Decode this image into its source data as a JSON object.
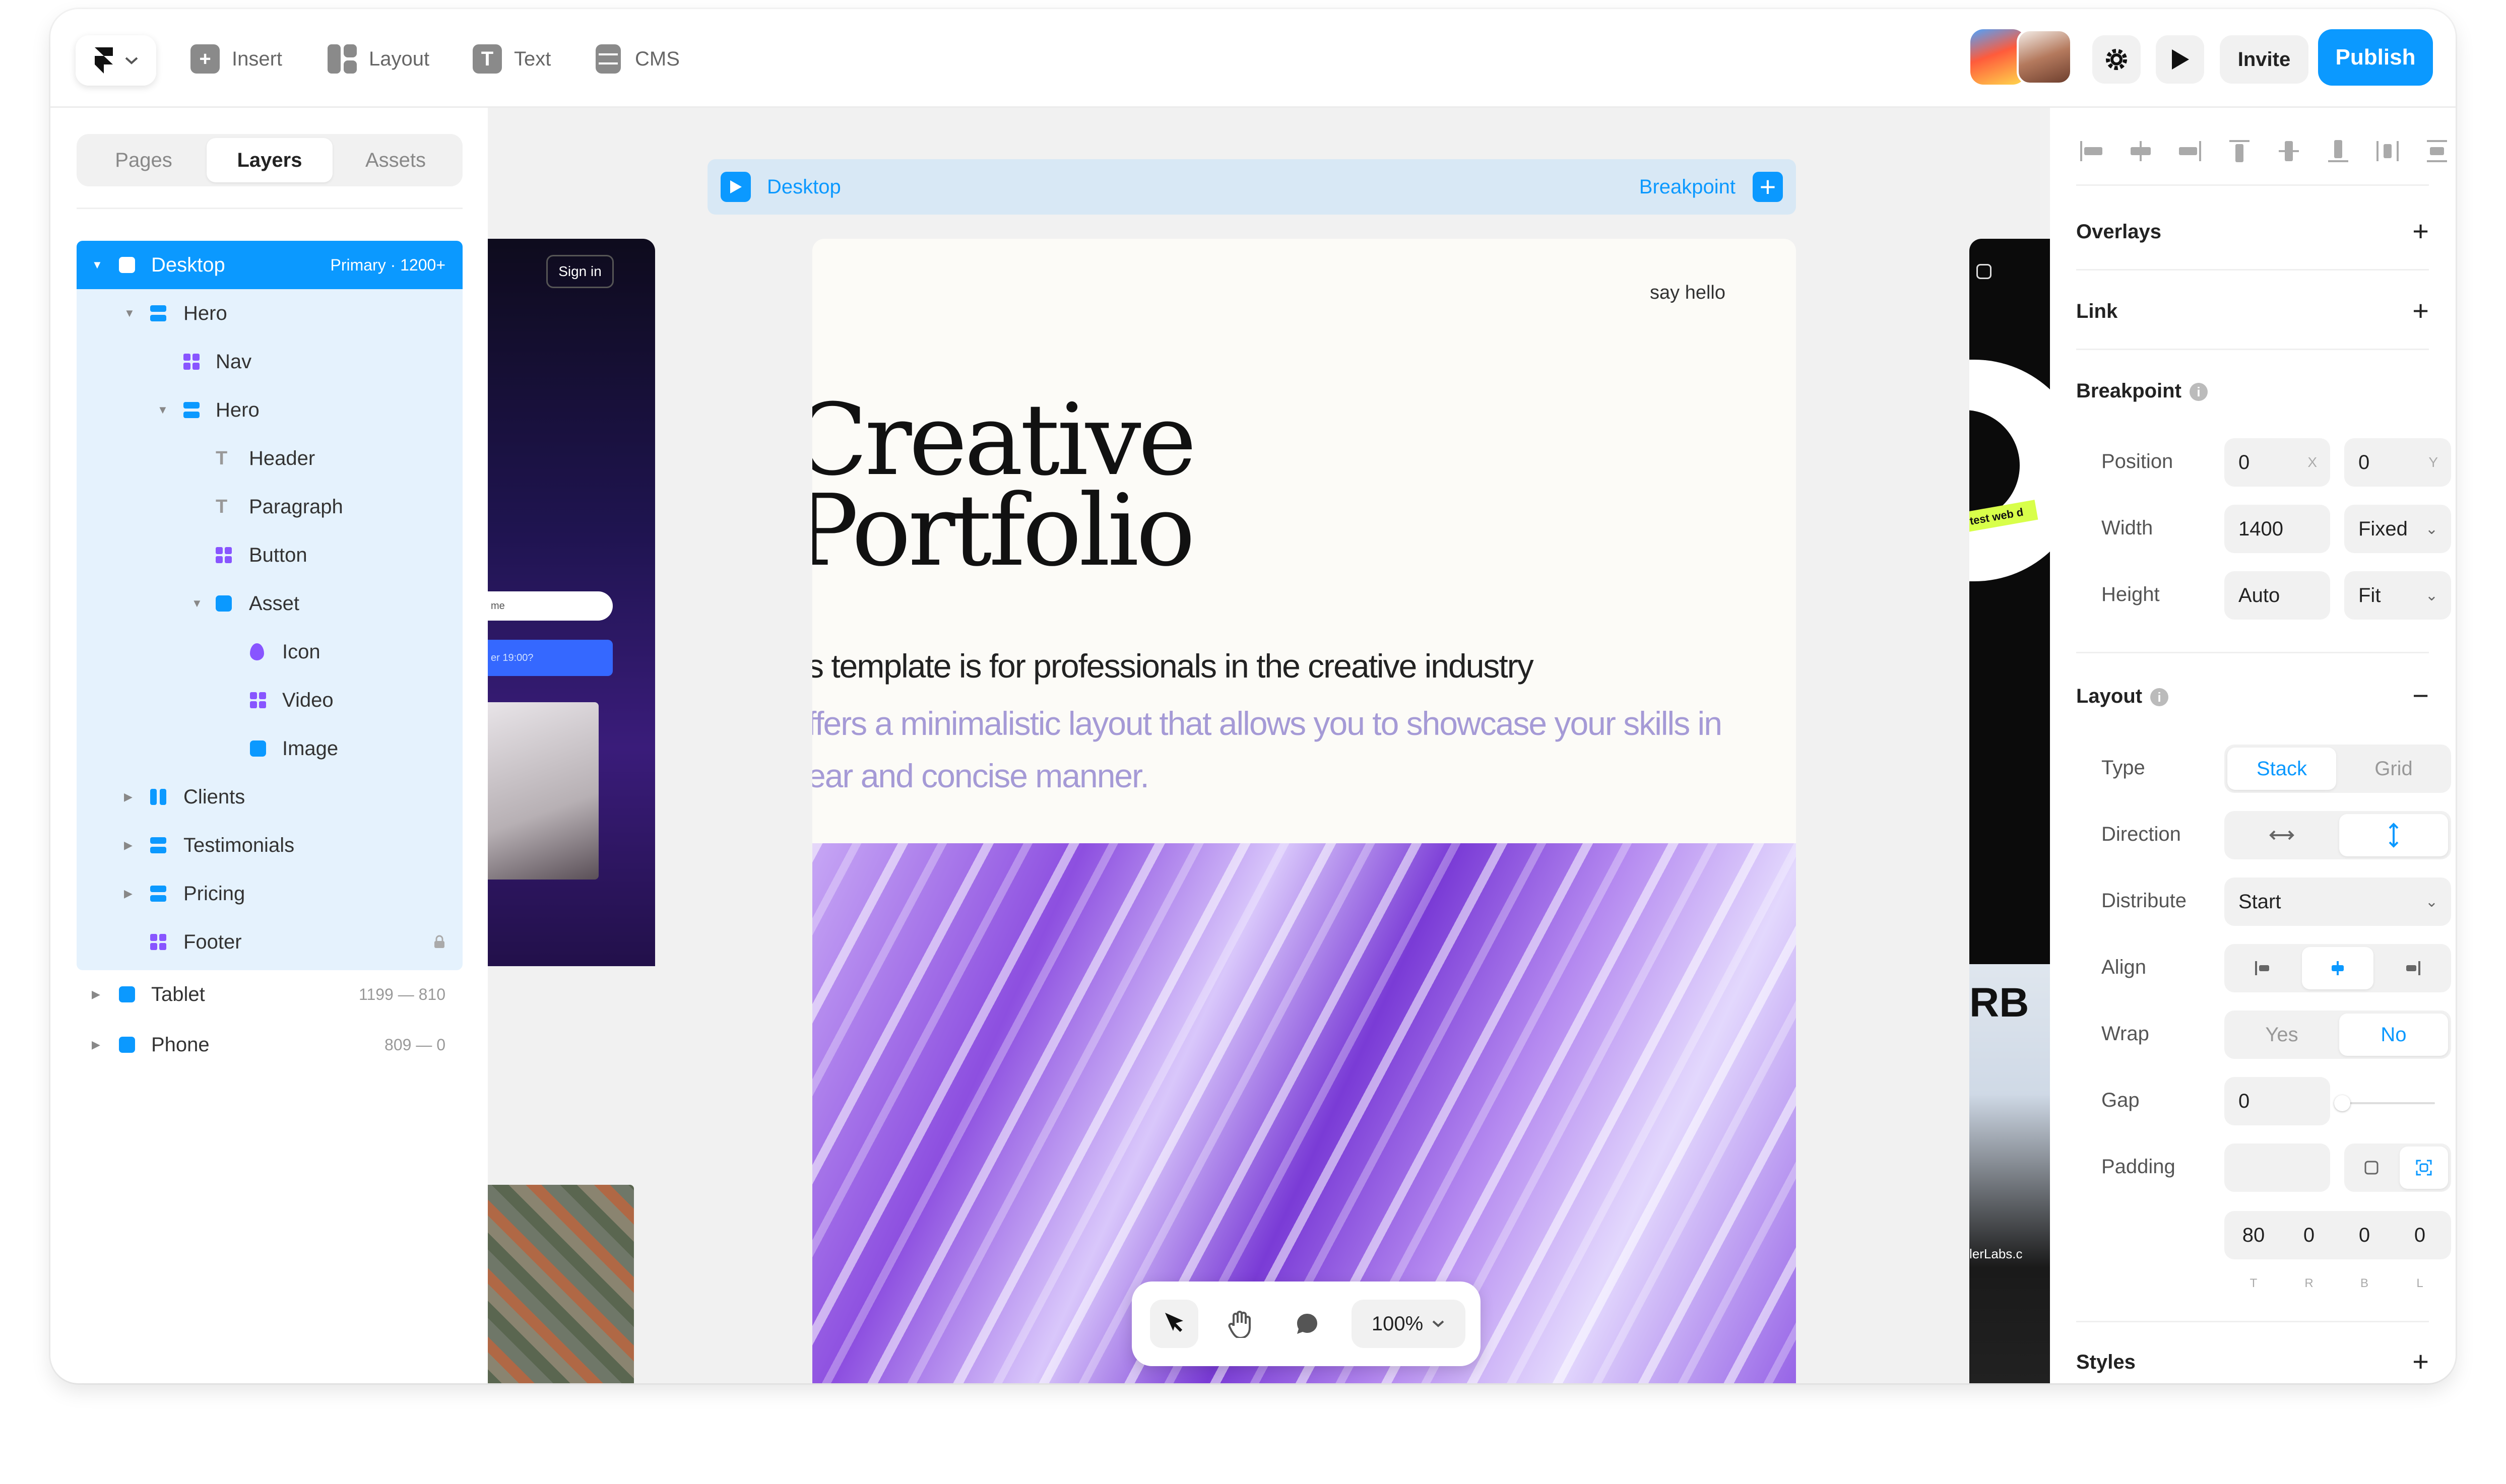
{
  "toolbar": {
    "menu_items": [
      {
        "label": "Insert",
        "icon": "plus-square-icon"
      },
      {
        "label": "Layout",
        "icon": "layout-icon"
      },
      {
        "label": "Text",
        "icon": "text-icon"
      },
      {
        "label": "CMS",
        "icon": "database-icon"
      }
    ],
    "invite_label": "Invite",
    "publish_label": "Publish",
    "accent_color": "#0b99ff"
  },
  "left_panel": {
    "tabs": [
      {
        "label": "Pages",
        "active": false
      },
      {
        "label": "Layers",
        "active": true
      },
      {
        "label": "Assets",
        "active": false
      }
    ],
    "layers": [
      {
        "label": "Desktop",
        "meta": "Primary · 1200+",
        "selected": true
      },
      {
        "label": "Hero"
      },
      {
        "label": "Nav"
      },
      {
        "label": "Hero"
      },
      {
        "label": "Header"
      },
      {
        "label": "Paragraph"
      },
      {
        "label": "Button"
      },
      {
        "label": "Asset"
      },
      {
        "label": "Icon"
      },
      {
        "label": "Video"
      },
      {
        "label": "Image"
      },
      {
        "label": "Clients"
      },
      {
        "label": "Testimonials"
      },
      {
        "label": "Pricing"
      },
      {
        "label": "Footer"
      },
      {
        "label": "Tablet",
        "meta": "1199 — 810"
      },
      {
        "label": "Phone",
        "meta": "809 — 0"
      }
    ]
  },
  "canvas": {
    "breakpoint_bar": {
      "label": "Desktop",
      "action": "Breakpoint"
    },
    "page": {
      "say_hello": "say hello",
      "title_line1": "Creative",
      "title_line2": "Portfolio",
      "paragraph_line1": "s template is for professionals in the creative industry",
      "paragraph_line2": "ffers a minimalistic layout that allows you to showcase your skills in",
      "paragraph_line3": "ear and concise manner."
    },
    "left_preview": {
      "sign_in": "Sign in",
      "input_text": "me",
      "button_text": "er 19:00?"
    },
    "right_preview": {
      "tag": "test web d",
      "big_text": "RB",
      "labs_text": "lerLabs.c"
    },
    "zoom_level": "100%"
  },
  "right_panel": {
    "sections": {
      "overlays": "Overlays",
      "link": "Link",
      "breakpoint": "Breakpoint",
      "layout": "Layout",
      "styles": "Styles"
    },
    "breakpoint": {
      "position_label": "Position",
      "position_x": "0",
      "position_x_suffix": "X",
      "position_y": "0",
      "position_y_suffix": "Y",
      "width_label": "Width",
      "width_value": "1400",
      "width_mode": "Fixed",
      "height_label": "Height",
      "height_value": "Auto",
      "height_mode": "Fit"
    },
    "layout": {
      "type_label": "Type",
      "type_options": [
        "Stack",
        "Grid"
      ],
      "type_selected": "Stack",
      "direction_label": "Direction",
      "distribute_label": "Distribute",
      "distribute_value": "Start",
      "align_label": "Align",
      "wrap_label": "Wrap",
      "wrap_options": [
        "Yes",
        "No"
      ],
      "wrap_selected": "No",
      "gap_label": "Gap",
      "gap_value": "0",
      "padding_label": "Padding",
      "padding_values": [
        "80",
        "0",
        "0",
        "0"
      ],
      "padding_sides": [
        "T",
        "R",
        "B",
        "L"
      ]
    }
  }
}
